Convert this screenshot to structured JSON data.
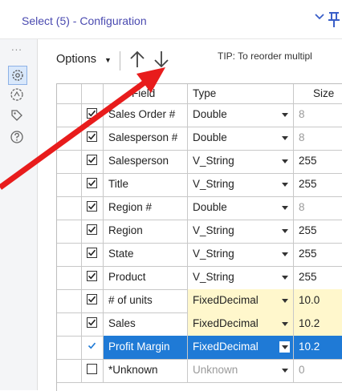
{
  "window": {
    "title": "Select (5) - Configuration",
    "chevron_icon": "chevron-down-icon",
    "pin_icon": "pin-icon"
  },
  "sidebar": {
    "dots": "...",
    "icons": [
      "configuration-gear-icon",
      "annotation-icon",
      "tag-icon",
      "help-icon"
    ]
  },
  "toolbar": {
    "options_label": "Options",
    "up_icon": "arrow-up-icon",
    "down_icon": "arrow-down-icon",
    "tip": "TIP: To reorder multipl"
  },
  "grid": {
    "columns": [
      "Field",
      "Type",
      "Size"
    ],
    "rows": [
      {
        "checked": true,
        "field": "Sales Order #",
        "type": "Double",
        "size": "8",
        "size_grey": true,
        "fixed": false
      },
      {
        "checked": true,
        "field": "Salesperson #",
        "type": "Double",
        "size": "8",
        "size_grey": true,
        "fixed": false
      },
      {
        "checked": true,
        "field": "Salesperson",
        "type": "V_String",
        "size": "255",
        "size_grey": false,
        "fixed": false
      },
      {
        "checked": true,
        "field": "Title",
        "type": "V_String",
        "size": "255",
        "size_grey": false,
        "fixed": false
      },
      {
        "checked": true,
        "field": "Region #",
        "type": "Double",
        "size": "8",
        "size_grey": true,
        "fixed": false
      },
      {
        "checked": true,
        "field": "Region",
        "type": "V_String",
        "size": "255",
        "size_grey": false,
        "fixed": false
      },
      {
        "checked": true,
        "field": "State",
        "type": "V_String",
        "size": "255",
        "size_grey": false,
        "fixed": false
      },
      {
        "checked": true,
        "field": "Product",
        "type": "V_String",
        "size": "255",
        "size_grey": false,
        "fixed": false
      },
      {
        "checked": true,
        "field": "# of units",
        "type": "FixedDecimal",
        "size": "10.0",
        "size_grey": false,
        "fixed": true
      },
      {
        "checked": true,
        "field": "Sales",
        "type": "FixedDecimal",
        "size": "10.2",
        "size_grey": false,
        "fixed": true
      },
      {
        "checked": true,
        "field": "Profit Margin",
        "type": "FixedDecimal",
        "size": "10.2",
        "size_grey": false,
        "fixed": true,
        "selected": true
      },
      {
        "checked": false,
        "field": "*Unknown",
        "type": "Unknown",
        "size": "0",
        "size_grey": true,
        "fixed": false,
        "type_grey": true
      }
    ]
  },
  "annotation": {
    "color": "#e81c1c",
    "icon": "red-arrow-annotation"
  }
}
